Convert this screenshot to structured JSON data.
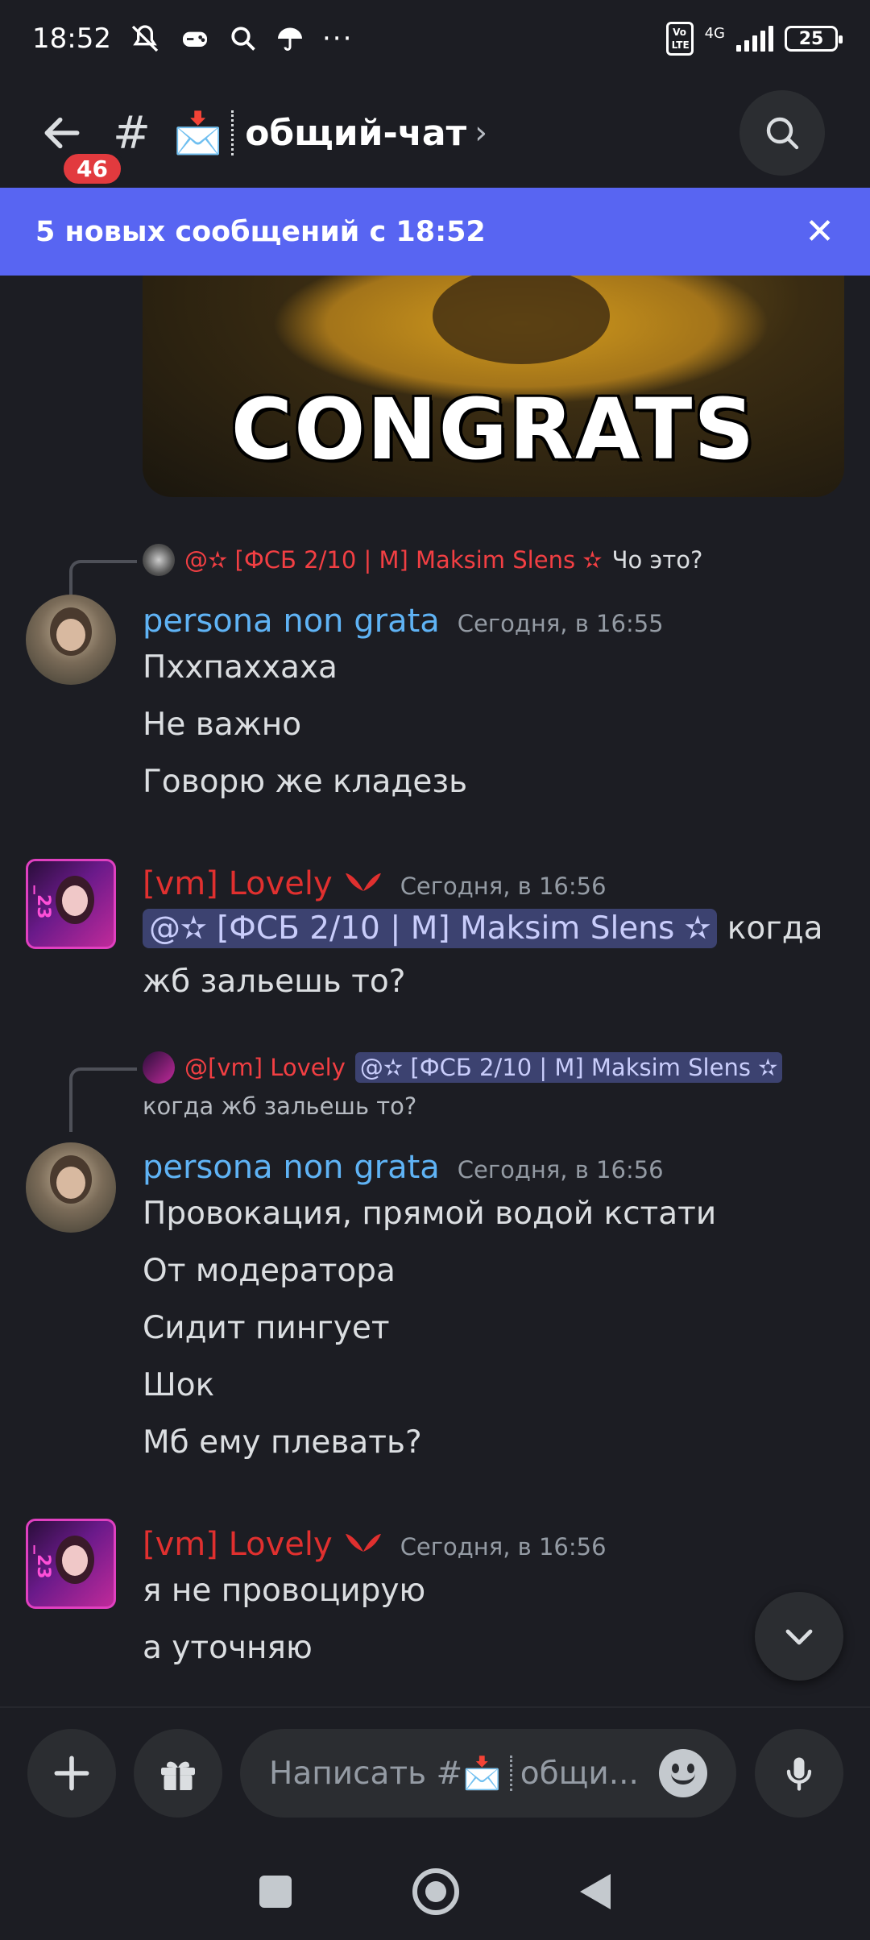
{
  "status_bar": {
    "time": "18:52",
    "network": "4G",
    "volte": "Vo LTE",
    "battery": "25",
    "icons": [
      "mute-icon",
      "game-icon",
      "search-icon",
      "umbrella-icon",
      "more-icon"
    ]
  },
  "header": {
    "unread_badge": "46",
    "channel_hash": "#",
    "channel_emoji": "📩",
    "channel_name": "общий-чат",
    "chevron": "›"
  },
  "banner": {
    "text": "5 новых сообщений с 18:52",
    "close": "✕"
  },
  "gif": {
    "caption": "CONGRATS"
  },
  "messages": [
    {
      "reply_to": {
        "author": "@✫ [ФСБ 2/10 | M] Maksim Slens ✫",
        "text": "Чо это?"
      },
      "author": "persona non grata",
      "timestamp": "Сегодня, в 16:55",
      "lines": [
        "Пххпаххаха",
        "Не важно",
        "Говорю же кладезь"
      ]
    },
    {
      "author": "[vm] Lovely",
      "timestamp": "Сегодня, в 16:56",
      "avatar_label": "_23",
      "mention": "@✫ [ФСБ 2/10 | M] Maksim Slens ✫",
      "text_after_mention": " когда",
      "lines": [
        "жб зальешь то?"
      ]
    },
    {
      "reply_to": {
        "author": "@[vm] Lovely",
        "mention": "@✫ [ФСБ 2/10 | M] Maksim Slens ✫",
        "text": "когда жб зальешь то?"
      },
      "author": "persona non grata",
      "timestamp": "Сегодня, в 16:56",
      "lines": [
        "Провокация, прямой водой кстати",
        "От модератора",
        "Сидит пингует",
        "Шок",
        "Мб ему плевать?"
      ]
    },
    {
      "author": "[vm] Lovely",
      "timestamp": "Сегодня, в 16:56",
      "avatar_label": "_23",
      "lines": [
        "я не провоцирую",
        "а уточняю"
      ]
    }
  ],
  "composer": {
    "placeholder_prefix": "Написать #",
    "placeholder_emoji": "📩",
    "placeholder_channel": "общи..."
  },
  "colors": {
    "background": "#1c1d23",
    "banner": "#5865f2",
    "username_blue": "#5fb3f5",
    "username_red": "#e0302f",
    "badge": "#e23a3e"
  }
}
